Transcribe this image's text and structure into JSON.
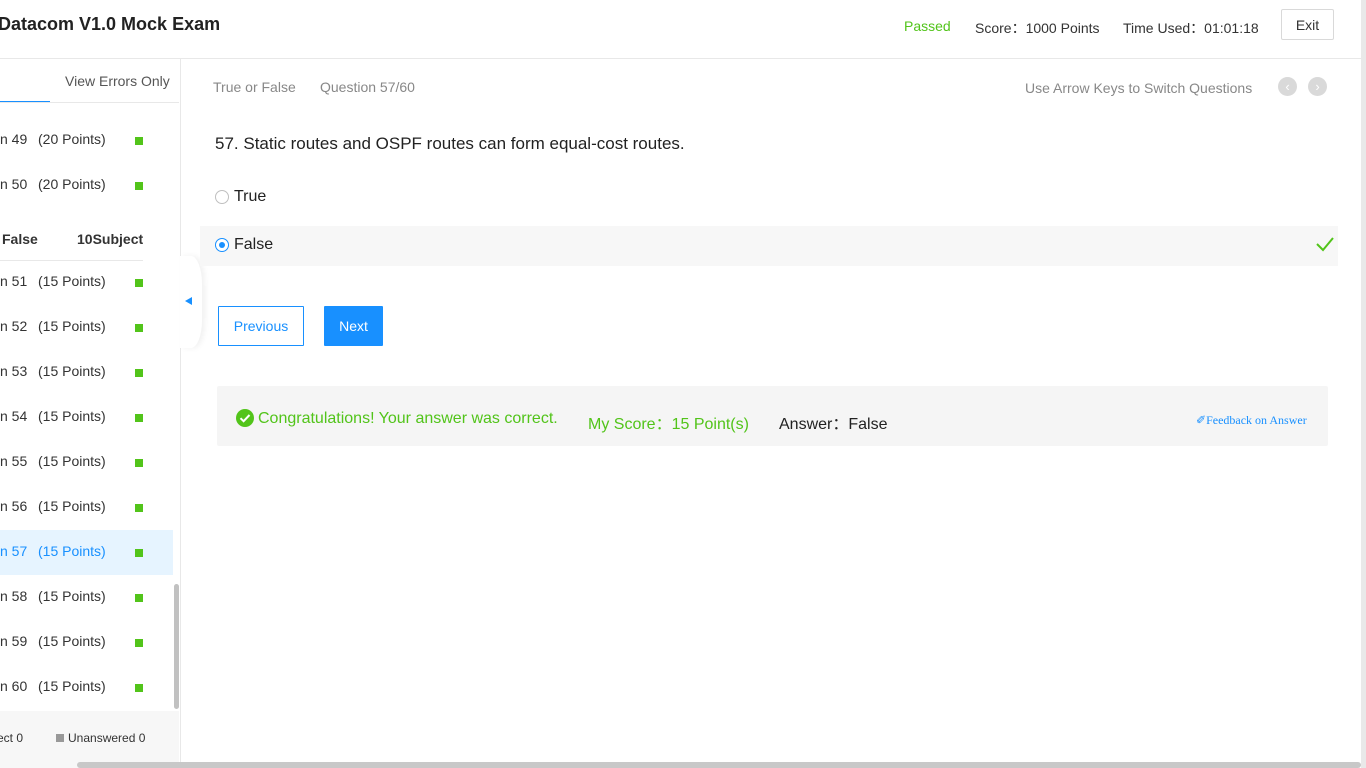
{
  "header": {
    "title": "Datacom V1.0 Mock Exam",
    "status": "Passed",
    "score": "Score：1000 Points",
    "time_used": "Time Used：01:01:18",
    "exit_label": "Exit"
  },
  "sidebar": {
    "tab_errors": "View Errors Only",
    "section": {
      "type": "False",
      "count": "10Subject"
    },
    "items": [
      {
        "label": "n 49",
        "points": "(20 Points)"
      },
      {
        "label": "n 50",
        "points": "(20 Points)"
      },
      {
        "label": "n 51",
        "points": "(15 Points)"
      },
      {
        "label": "n 52",
        "points": "(15 Points)"
      },
      {
        "label": "n 53",
        "points": "(15 Points)"
      },
      {
        "label": "n 54",
        "points": "(15 Points)"
      },
      {
        "label": "n 55",
        "points": "(15 Points)"
      },
      {
        "label": "n 56",
        "points": "(15 Points)"
      },
      {
        "label": "n 57",
        "points": "(15 Points)"
      },
      {
        "label": "n 58",
        "points": "(15 Points)"
      },
      {
        "label": "n 59",
        "points": "(15 Points)"
      },
      {
        "label": "n 60",
        "points": "(15 Points)"
      }
    ],
    "legend": {
      "correct": "ect 0",
      "unanswered": "Unanswered 0"
    }
  },
  "main": {
    "question_type": "True or False",
    "question_number": "Question 57/60",
    "arrow_hint": "Use Arrow Keys to Switch Questions",
    "question_text": "57. Static routes and OSPF routes can form equal-cost routes.",
    "options": [
      {
        "label": "True",
        "selected": false
      },
      {
        "label": "False",
        "selected": true
      }
    ],
    "previous_label": "Previous",
    "next_label": "Next"
  },
  "result": {
    "message": "Congratulations! Your answer was correct.",
    "my_score": "My Score：15 Point(s)",
    "answer": "Answer：False",
    "feedback": "Feedback on Answer"
  },
  "colors": {
    "accent": "#1890ff",
    "success": "#52c41a"
  }
}
